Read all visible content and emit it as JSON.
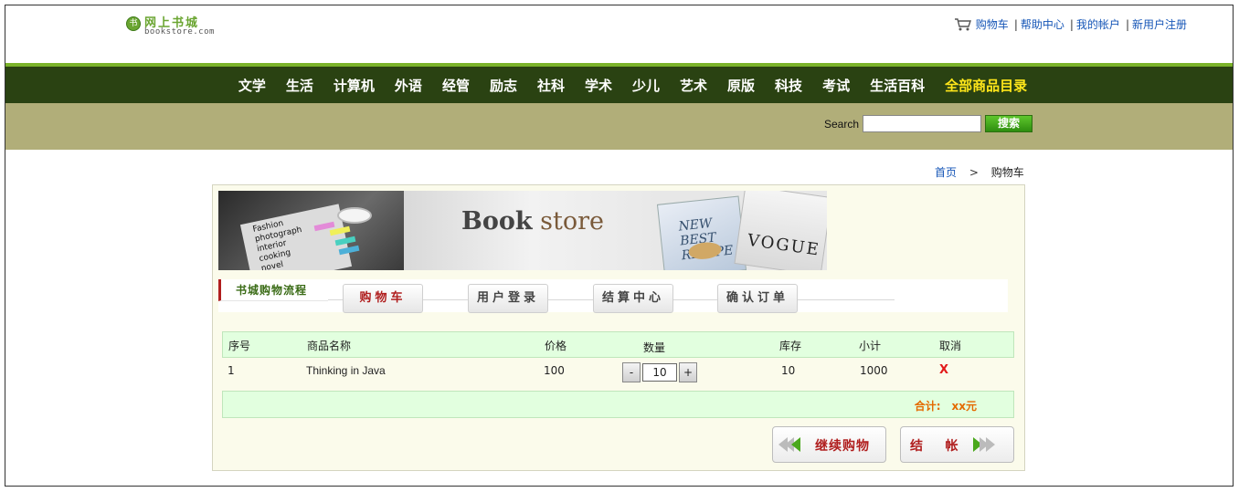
{
  "header": {
    "logo_title": "网上书城",
    "logo_subtitle": "bookstore.com",
    "links": [
      "购物车",
      "帮助中心",
      "我的帐户",
      "新用户注册"
    ],
    "separator": "|"
  },
  "nav": {
    "items": [
      "文学",
      "生活",
      "计算机",
      "外语",
      "经管",
      "励志",
      "社科",
      "学术",
      "少儿",
      "艺术",
      "原版",
      "科技",
      "考试",
      "生活百科"
    ],
    "all_label": "全部商品目录",
    "highlight_color": "#ffe61a"
  },
  "search": {
    "label": "Search",
    "value": "",
    "button": "搜索"
  },
  "breadcrumb": {
    "home": "首页",
    "arrow": ">",
    "current": "购物车"
  },
  "banner": {
    "title_a": "Book",
    "title_b": "store",
    "words": [
      "Fashion",
      "photograph",
      "interior",
      "cooking",
      "novel"
    ],
    "book1_title": "NEW BEST RECIPE",
    "book2_title": "VOGUE"
  },
  "process": {
    "title": "书城购物流程",
    "steps": [
      "购物车",
      "用户登录",
      "结算中心",
      "确认订单"
    ]
  },
  "table": {
    "headers": [
      "序号",
      "商品名称",
      "价格",
      "数量",
      "库存",
      "小计",
      "取消"
    ],
    "rows": [
      {
        "index": "1",
        "name": "Thinking in Java",
        "price": "100",
        "qty": "10",
        "stock": "10",
        "subtotal": "1000",
        "cancel": "X"
      }
    ],
    "total_label": "合计:",
    "total_value": "xx元",
    "qty_minus": "-",
    "qty_plus": "+"
  },
  "buttons": {
    "continue": "继续购物",
    "checkout": "结    帐"
  }
}
